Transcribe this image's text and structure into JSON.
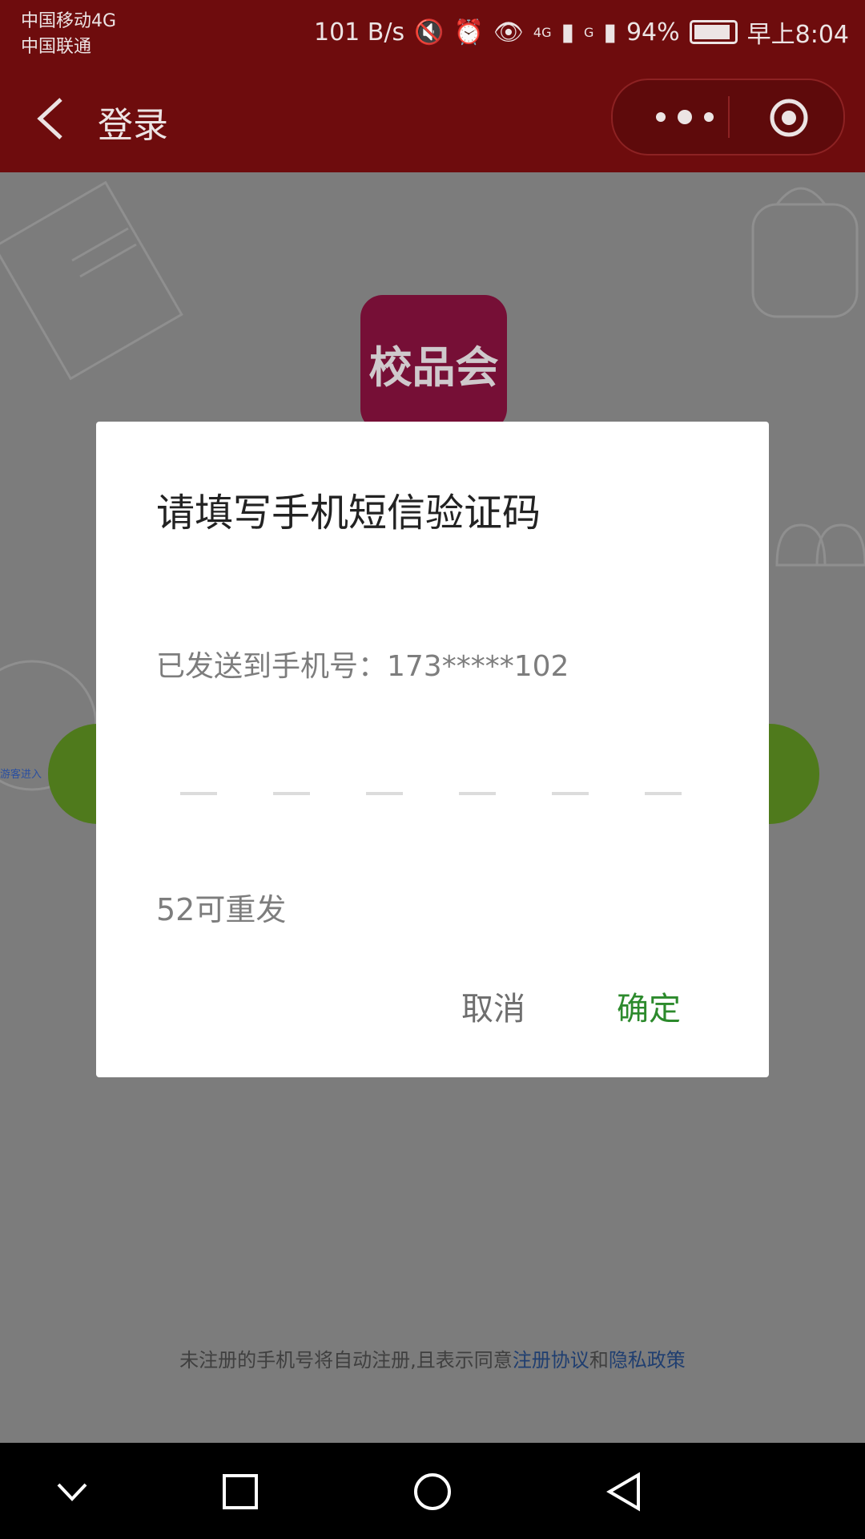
{
  "status_bar": {
    "carrier_1": "中国移动4G",
    "carrier_2": "中国联通",
    "net_speed": "101 B/s",
    "signal_1": "4G",
    "signal_2": "G",
    "battery": "94%",
    "time": "早上8:04"
  },
  "header": {
    "title": "登录",
    "back_icon": "chevron-left-icon",
    "more_icon": "more-dots-icon",
    "close_icon": "capsule-close-icon"
  },
  "page": {
    "logo_text": "校品会",
    "tiny_link": "游客进入",
    "agreement_prefix": "未注册的手机号将自动注册,且表示同意",
    "agreement_link_1": "注册协议",
    "agreement_joiner": "和",
    "agreement_link_2": "隐私政策"
  },
  "dialog": {
    "title": "请填写手机短信验证码",
    "subtitle": "已发送到手机号：173*****102",
    "code_slot_count": 6,
    "resend": "52可重发",
    "cancel_label": "取消",
    "confirm_label": "确定"
  },
  "colors": {
    "header_bg": "#6e0c0d",
    "confirm": "#2c8a2c",
    "logo_bg": "#760f36",
    "accent_green": "#4f7a1c"
  }
}
